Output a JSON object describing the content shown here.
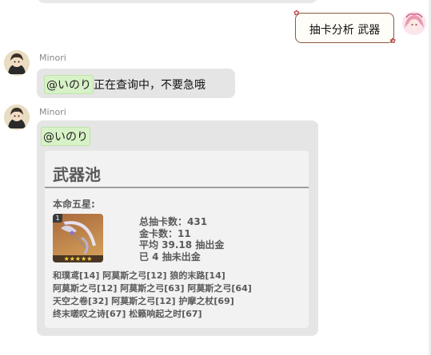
{
  "outgoing": {
    "text": "抽卡分析 武器"
  },
  "messages": [
    {
      "sender": "Minori",
      "mention": "@いのり",
      "text": "正在查询中，不要急哦"
    },
    {
      "sender": "Minori",
      "mention": "@いのり",
      "card": {
        "title": "武器池",
        "section": "本命五星:",
        "weapon_badge": "1",
        "weapon_stars": "★★★★★",
        "stats": [
          "总抽卡数：431",
          "金卡数：11",
          "平均 39.18 抽出金",
          "已 4 抽未出金"
        ],
        "records": [
          "和璞鸢[14] 阿莫斯之弓[12] 狼的末路[14]",
          "阿莫斯之弓[12] 阿莫斯之弓[63] 阿莫斯之弓[64]",
          "天空之卷[32] 阿莫斯之弓[12] 护摩之杖[69]",
          "终末嗟叹之诗[67] 松籁响起之时[67]"
        ]
      }
    }
  ]
}
